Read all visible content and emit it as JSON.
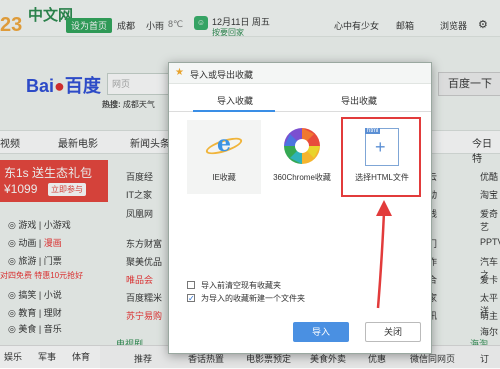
{
  "background": {
    "logo_text": "中文网",
    "logo_num": "23",
    "home_button": "设为首页",
    "weather": {
      "city": "成都",
      "text": "小雨",
      "temp": "8℃"
    },
    "date": "12月11日 周五",
    "fortune": "按要回家",
    "user": "心中有少女",
    "mail": "邮箱",
    "browser": "浏览器",
    "search": {
      "logo": "百度",
      "placeholder": "网页",
      "button": "百度一下"
    },
    "hot": {
      "label": "热搜:",
      "item": "成都天气"
    },
    "nav": [
      "视频",
      "最新电影",
      "新闻头条",
      "今日特"
    ],
    "promo": {
      "line1": "东1s 送生态礼包",
      "price": "¥1099",
      "button": "立即参与"
    },
    "side_links": [
      {
        "a": "游戏",
        "b": "小游戏"
      },
      {
        "a": "动画",
        "b": "漫画"
      },
      {
        "a": "旅游",
        "b": "门票"
      },
      {
        "a": "搞笑",
        "b": "小说"
      },
      {
        "a": "教育",
        "b": "理财"
      },
      {
        "a": "美食",
        "b": "音乐"
      }
    ],
    "side_promo": "对四免费 特惠10元抢好",
    "center_links": [
      "百度经",
      "IT之家",
      "凤凰网",
      "东方财富",
      "聚美优品",
      "唯品会",
      "百度糯米",
      "苏宁易购"
    ],
    "right_links": [
      "云",
      "动",
      "线",
      "门",
      "作",
      "合",
      "家",
      "讯"
    ],
    "far_right": [
      "优酷",
      "淘宝",
      "爱奇艺",
      "PPTV",
      "汽车之",
      "爱卡",
      "太平洋",
      "萌主",
      "海尔"
    ],
    "tv": "电视剧",
    "haitao": "海淘",
    "bottom_tabs": [
      "娱乐",
      "军事",
      "体育"
    ],
    "bottom_bar": [
      "推荐",
      "香话热置",
      "电影票预定",
      "美食外卖",
      "优惠",
      "微信同网页",
      "订"
    ]
  },
  "dialog": {
    "title": "导入或导出收藏",
    "tabs": [
      "导入收藏",
      "导出收藏"
    ],
    "options": [
      {
        "label": "IE收藏",
        "icon": "ie-icon"
      },
      {
        "label": "360Chrome收藏",
        "icon": "chrome-icon"
      },
      {
        "label": "选择HTML文件",
        "icon": "html-file-icon",
        "tag": "html"
      }
    ],
    "checkbox1": {
      "label": "导入前清空现有收藏夹",
      "checked": false
    },
    "checkbox2": {
      "label": "为导入的收藏新建一个文件夹",
      "checked": true
    },
    "import_button": "导入",
    "close_button": "关闭"
  }
}
